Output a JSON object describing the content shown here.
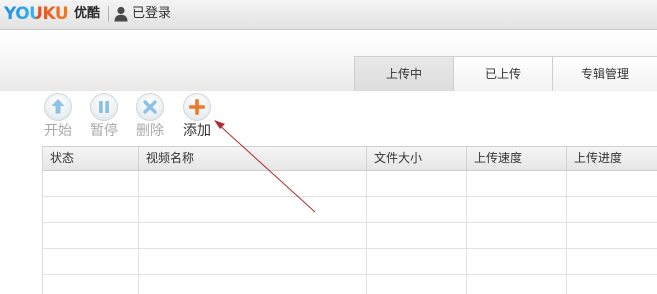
{
  "header": {
    "logo_latin": "YOUKU",
    "logo_chinese": "优酷",
    "user_status": "已登录"
  },
  "tabs": [
    {
      "label": "上传中",
      "active": true
    },
    {
      "label": "已上传",
      "active": false
    },
    {
      "label": "专辑管理",
      "active": false
    }
  ],
  "toolbar": [
    {
      "label": "开始",
      "icon": "up-arrow-icon",
      "enabled": false
    },
    {
      "label": "暂停",
      "icon": "pause-icon",
      "enabled": false
    },
    {
      "label": "删除",
      "icon": "x-icon",
      "enabled": false
    },
    {
      "label": "添加",
      "icon": "plus-icon",
      "enabled": true
    }
  ],
  "table": {
    "columns": [
      "状态",
      "视频名称",
      "文件大小",
      "上传速度",
      "上传进度"
    ],
    "rows": []
  },
  "colors": {
    "logo_blue": "#1e8fe6",
    "logo_orange": "#ec4a1c",
    "icon_blue": "#8cc2e8",
    "add_orange": "#f0762a",
    "annotation_arrow": "#b5282e"
  }
}
